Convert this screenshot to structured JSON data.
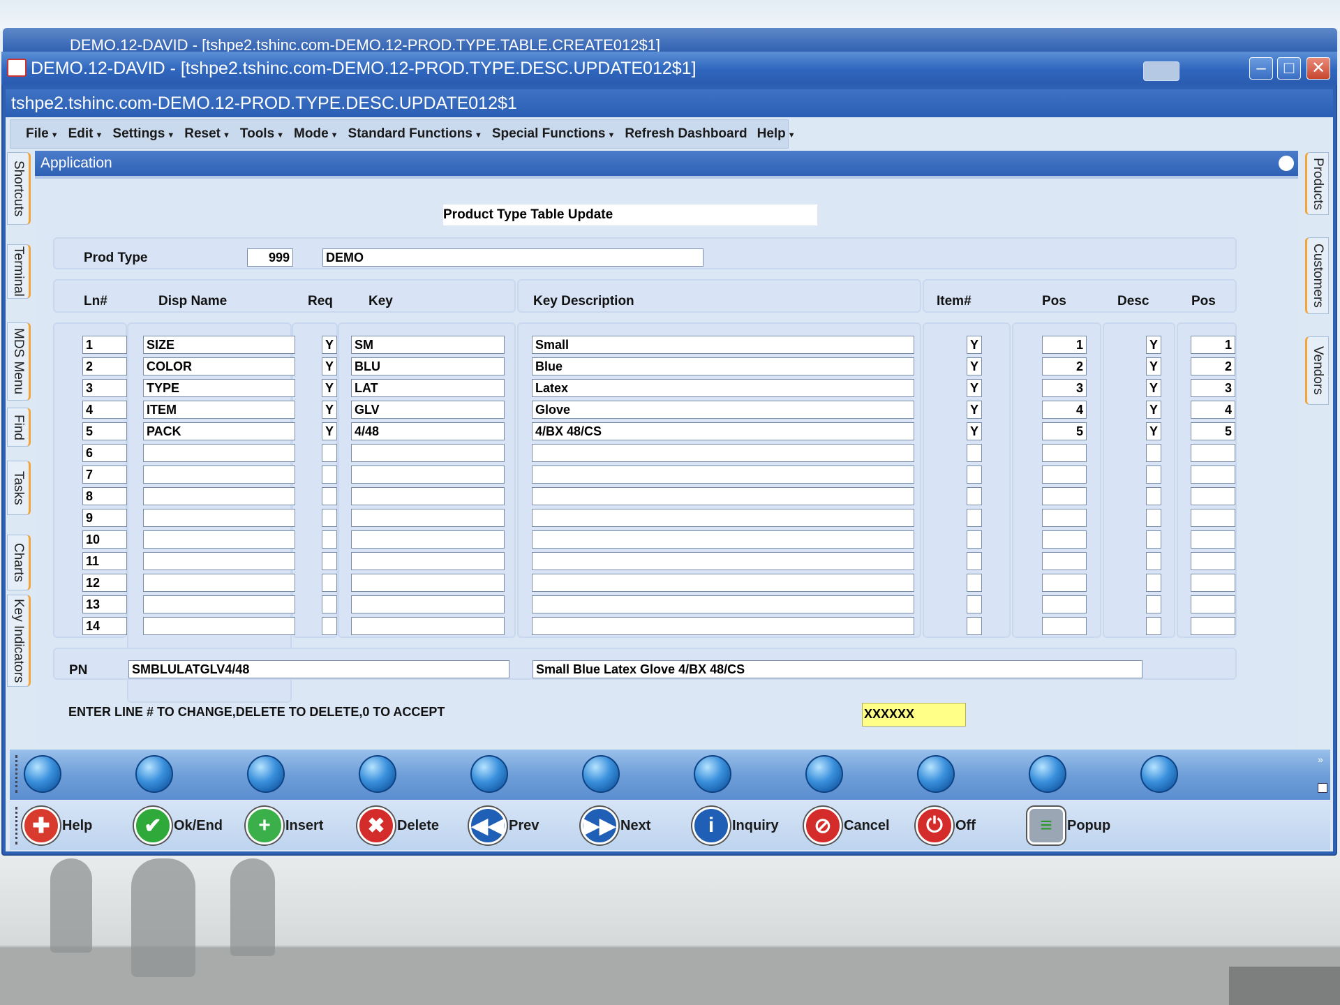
{
  "back_window": {
    "title": "DEMO.12-DAVID - [tshpe2.tshinc.com-DEMO.12-PROD.TYPE.TABLE.CREATE012$1]"
  },
  "window": {
    "title": "DEMO.12-DAVID - [tshpe2.tshinc.com-DEMO.12-PROD.TYPE.DESC.UPDATE012$1]",
    "subtitle": "tshpe2.tshinc.com-DEMO.12-PROD.TYPE.DESC.UPDATE012$1"
  },
  "menu": [
    "File",
    "Edit",
    "Settings",
    "Reset",
    "Tools",
    "Mode",
    "Standard Functions",
    "Special Functions",
    "Refresh Dashboard",
    "Help"
  ],
  "menu_plain": "Refresh Dashboard",
  "left_tabs": [
    "Shortcuts",
    "Terminal",
    "MDS Menu",
    "Find",
    "Tasks",
    "Charts",
    "Key Indicators"
  ],
  "right_tabs": [
    "Products",
    "Customers",
    "Vendors"
  ],
  "app": {
    "header": "Application",
    "form_title": "Product Type Table Update",
    "prod_type_label": "Prod Type",
    "prod_type_value": "999",
    "prod_type_desc": "DEMO",
    "columns": {
      "ln": "Ln#",
      "disp_name": "Disp Name",
      "req": "Req",
      "key": "Key",
      "key_desc": "Key Description",
      "item": "Item#",
      "pos": "Pos",
      "desc": "Desc",
      "pos2": "Pos"
    },
    "rows": [
      {
        "ln": "1",
        "disp": "SIZE",
        "req": "Y",
        "key": "SM",
        "kdesc": "Small",
        "item": "Y",
        "pos": "1",
        "desc": "Y",
        "pos2": "1"
      },
      {
        "ln": "2",
        "disp": "COLOR",
        "req": "Y",
        "key": "BLU",
        "kdesc": "Blue",
        "item": "Y",
        "pos": "2",
        "desc": "Y",
        "pos2": "2"
      },
      {
        "ln": "3",
        "disp": "TYPE",
        "req": "Y",
        "key": "LAT",
        "kdesc": "Latex",
        "item": "Y",
        "pos": "3",
        "desc": "Y",
        "pos2": "3"
      },
      {
        "ln": "4",
        "disp": "ITEM",
        "req": "Y",
        "key": "GLV",
        "kdesc": "Glove",
        "item": "Y",
        "pos": "4",
        "desc": "Y",
        "pos2": "4"
      },
      {
        "ln": "5",
        "disp": "PACK",
        "req": "Y",
        "key": "4/48",
        "kdesc": "4/BX 48/CS",
        "item": "Y",
        "pos": "5",
        "desc": "Y",
        "pos2": "5"
      },
      {
        "ln": "6",
        "disp": "",
        "req": "",
        "key": "",
        "kdesc": "",
        "item": "",
        "pos": "",
        "desc": "",
        "pos2": ""
      },
      {
        "ln": "7",
        "disp": "",
        "req": "",
        "key": "",
        "kdesc": "",
        "item": "",
        "pos": "",
        "desc": "",
        "pos2": ""
      },
      {
        "ln": "8",
        "disp": "",
        "req": "",
        "key": "",
        "kdesc": "",
        "item": "",
        "pos": "",
        "desc": "",
        "pos2": ""
      },
      {
        "ln": "9",
        "disp": "",
        "req": "",
        "key": "",
        "kdesc": "",
        "item": "",
        "pos": "",
        "desc": "",
        "pos2": ""
      },
      {
        "ln": "10",
        "disp": "",
        "req": "",
        "key": "",
        "kdesc": "",
        "item": "",
        "pos": "",
        "desc": "",
        "pos2": ""
      },
      {
        "ln": "11",
        "disp": "",
        "req": "",
        "key": "",
        "kdesc": "",
        "item": "",
        "pos": "",
        "desc": "",
        "pos2": ""
      },
      {
        "ln": "12",
        "disp": "",
        "req": "",
        "key": "",
        "kdesc": "",
        "item": "",
        "pos": "",
        "desc": "",
        "pos2": ""
      },
      {
        "ln": "13",
        "disp": "",
        "req": "",
        "key": "",
        "kdesc": "",
        "item": "",
        "pos": "",
        "desc": "",
        "pos2": ""
      },
      {
        "ln": "14",
        "disp": "",
        "req": "",
        "key": "",
        "kdesc": "",
        "item": "",
        "pos": "",
        "desc": "",
        "pos2": ""
      }
    ],
    "pn_label": "PN",
    "pn_value": "SMBLULATGLV4/48",
    "pn_desc": "Small Blue Latex Glove 4/BX 48/CS",
    "prompt": "ENTER LINE # TO CHANGE,DELETE TO DELETE,0 TO ACCEPT",
    "input_value": "XXXXXX"
  },
  "commands": [
    {
      "label": "Help",
      "icon": "lifebuoy-icon",
      "color": "#d83a2e",
      "glyph": "✚"
    },
    {
      "label": "Ok/End",
      "icon": "check-icon",
      "color": "#2faa3a",
      "glyph": "✔"
    },
    {
      "label": "Insert",
      "icon": "plus-icon",
      "color": "#3bb04a",
      "glyph": "+"
    },
    {
      "label": "Delete",
      "icon": "x-icon",
      "color": "#d42b2b",
      "glyph": "✖"
    },
    {
      "label": "Prev",
      "icon": "rewind-icon",
      "color": "#1f5fb5",
      "glyph": "◀◀"
    },
    {
      "label": "Next",
      "icon": "fast-forward-icon",
      "color": "#1f5fb5",
      "glyph": "▶▶"
    },
    {
      "label": "Inquiry",
      "icon": "info-icon",
      "color": "#1f5fb5",
      "glyph": "i"
    },
    {
      "label": "Cancel",
      "icon": "cancel-icon",
      "color": "#d42b2b",
      "glyph": "⊘"
    },
    {
      "label": "Off",
      "icon": "power-icon",
      "color": "#d42b2b",
      "glyph": "⏻"
    },
    {
      "label": "Popup",
      "icon": "database-icon",
      "color": "#9aa6b4",
      "glyph": "≡"
    }
  ]
}
